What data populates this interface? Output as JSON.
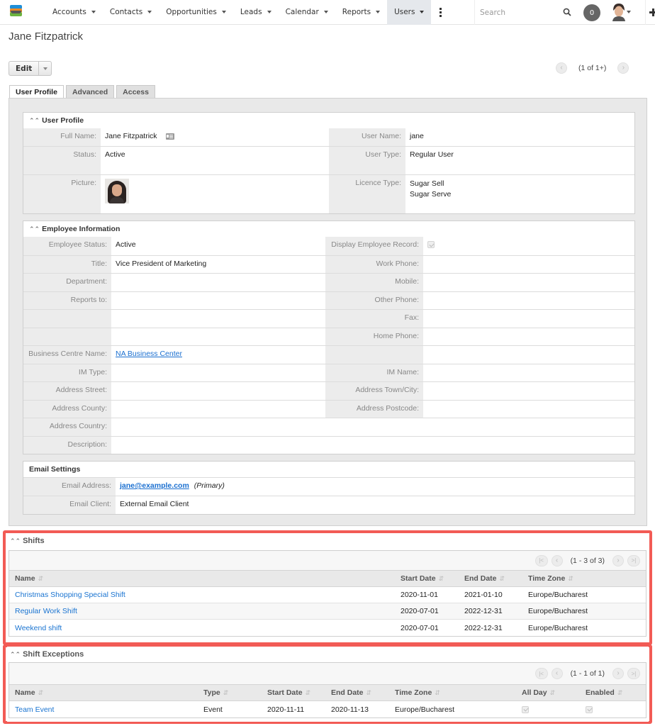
{
  "nav": {
    "items": [
      {
        "label": "Accounts"
      },
      {
        "label": "Contacts"
      },
      {
        "label": "Opportunities"
      },
      {
        "label": "Leads"
      },
      {
        "label": "Calendar"
      },
      {
        "label": "Reports"
      },
      {
        "label": "Users",
        "active": true
      }
    ],
    "search_placeholder": "Search",
    "notification_count": "0"
  },
  "record": {
    "title": "Jane Fitzpatrick",
    "edit_label": "Edit",
    "pager_text": "(1 of 1+)"
  },
  "tabs": [
    {
      "label": "User Profile",
      "active": true
    },
    {
      "label": "Advanced"
    },
    {
      "label": "Access"
    }
  ],
  "user_profile": {
    "header": "User Profile",
    "full_name_label": "Full Name:",
    "full_name": "Jane Fitzpatrick",
    "user_name_label": "User Name:",
    "user_name": "jane",
    "status_label": "Status:",
    "status": "Active",
    "user_type_label": "User Type:",
    "user_type": "Regular User",
    "picture_label": "Picture:",
    "licence_type_label": "Licence Type:",
    "licence_types": [
      "Sugar Sell",
      "Sugar Serve"
    ]
  },
  "employee_info": {
    "header": "Employee Information",
    "rows": [
      {
        "l1": "Employee Status:",
        "v1": "Active",
        "l2": "Display Employee Record:",
        "v2": ""
      },
      {
        "l1": "Title:",
        "v1": "Vice President of Marketing",
        "l2": "Work Phone:",
        "v2": ""
      },
      {
        "l1": "Department:",
        "v1": "",
        "l2": "Mobile:",
        "v2": ""
      },
      {
        "l1": "Reports to:",
        "v1": "",
        "l2": "Other Phone:",
        "v2": ""
      },
      {
        "l1": "",
        "v1": "",
        "l2": "Fax:",
        "v2": ""
      },
      {
        "l1": "",
        "v1": "",
        "l2": "Home Phone:",
        "v2": ""
      },
      {
        "l1": "Business Centre Name:",
        "v1": "NA Business Center",
        "l2": "",
        "v2": ""
      },
      {
        "l1": "IM Type:",
        "v1": "",
        "l2": "IM Name:",
        "v2": ""
      },
      {
        "l1": "Address Street:",
        "v1": "",
        "l2": "Address Town/City:",
        "v2": ""
      },
      {
        "l1": "Address County:",
        "v1": "",
        "l2": "Address Postcode:",
        "v2": ""
      }
    ],
    "country_label": "Address Country:",
    "country": "",
    "description_label": "Description:",
    "description": ""
  },
  "email_settings": {
    "header": "Email Settings",
    "email_label": "Email Address:",
    "email": "jane@example.com",
    "email_tag": "(Primary)",
    "client_label": "Email Client:",
    "client": "External Email Client"
  },
  "shifts": {
    "title": "Shifts",
    "pager_text": "(1 - 3 of 3)",
    "columns": [
      "Name",
      "Start Date",
      "End Date",
      "Time Zone"
    ],
    "rows": [
      {
        "name": "Christmas Shopping Special Shift",
        "start": "2020-11-01",
        "end": "2021-01-10",
        "tz": "Europe/Bucharest"
      },
      {
        "name": "Regular Work Shift",
        "start": "2020-07-01",
        "end": "2022-12-31",
        "tz": "Europe/Bucharest"
      },
      {
        "name": "Weekend shift",
        "start": "2020-07-01",
        "end": "2022-12-31",
        "tz": "Europe/Bucharest"
      }
    ]
  },
  "shift_exceptions": {
    "title": "Shift Exceptions",
    "pager_text": "(1 - 1 of 1)",
    "columns": [
      "Name",
      "Type",
      "Start Date",
      "End Date",
      "Time Zone",
      "All Day",
      "Enabled"
    ],
    "rows": [
      {
        "name": "Team Event",
        "type": "Event",
        "start": "2020-11-11",
        "end": "2020-11-13",
        "tz": "Europe/Bucharest",
        "all_day": true,
        "enabled": true
      }
    ]
  },
  "colors": {
    "accent_link": "#1a74d1",
    "highlight": "#f25b55"
  }
}
